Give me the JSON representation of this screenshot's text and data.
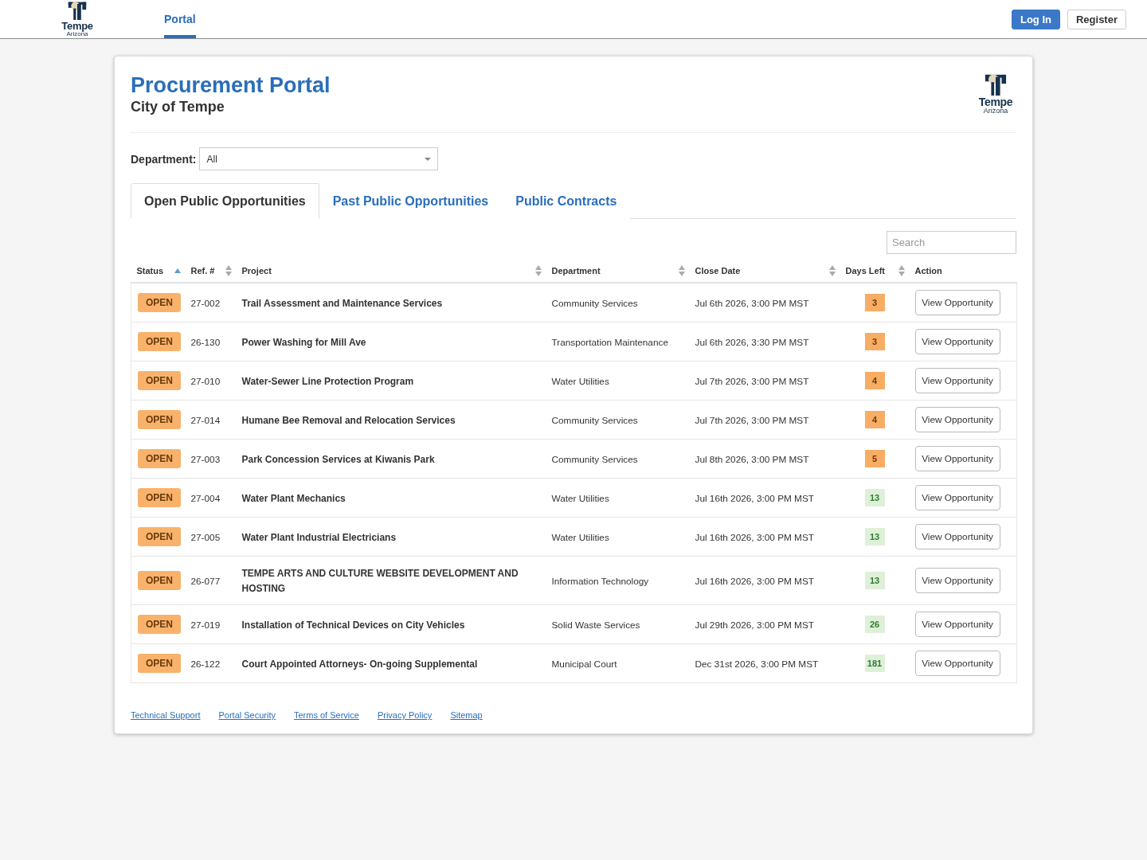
{
  "top_bar": {
    "logo": {
      "name": "Tempe",
      "region": "Arizona"
    },
    "nav": [
      {
        "label": "Portal",
        "selected": true
      }
    ],
    "buttons": [
      {
        "label": "Log In",
        "kind": "primary"
      },
      {
        "label": "Register",
        "kind": "secondary"
      }
    ]
  },
  "header": {
    "title": "Procurement Portal",
    "subtitle": "City of Tempe",
    "logo": {
      "name": "Tempe",
      "region": "Arizona"
    }
  },
  "filter": {
    "label": "Department:",
    "value": "All"
  },
  "tabs": [
    {
      "label": "Open Public Opportunities",
      "selected": true
    },
    {
      "label": "Past Public Opportunities",
      "selected": false
    },
    {
      "label": "Public Contracts",
      "selected": false
    }
  ],
  "search": {
    "placeholder": "Search"
  },
  "table": {
    "columns": [
      {
        "label": "Status",
        "sorted": true
      },
      {
        "label": "Ref. #",
        "sorted": false
      },
      {
        "label": "Project",
        "sorted": false
      },
      {
        "label": "Department",
        "sorted": false
      },
      {
        "label": "Close Date",
        "sorted": false
      },
      {
        "label": "Days Left",
        "sorted": false
      },
      {
        "label": "Action"
      }
    ],
    "rows": [
      {
        "status": "OPEN",
        "ref": "27-002",
        "project": "Trail Assessment and Maintenance Services",
        "department": "Community Services",
        "close_date": "Jul 6th 2026, 3:00 PM MST",
        "days_left": {
          "text": "3",
          "kind": "warning"
        },
        "action": "View Opportunity"
      },
      {
        "status": "OPEN",
        "ref": "26-130",
        "project": "Power Washing for Mill Ave",
        "department": "Transportation Maintenance",
        "close_date": "Jul 6th 2026, 3:30 PM MST",
        "days_left": {
          "text": "3",
          "kind": "warning"
        },
        "action": "View Opportunity"
      },
      {
        "status": "OPEN",
        "ref": "27-010",
        "project": "Water-Sewer Line Protection Program",
        "department": "Water Utilities",
        "close_date": "Jul 7th 2026, 3:00 PM MST",
        "days_left": {
          "text": "4",
          "kind": "warning"
        },
        "action": "View Opportunity"
      },
      {
        "status": "OPEN",
        "ref": "27-014",
        "project": "Humane Bee Removal and Relocation Services",
        "department": "Community Services",
        "close_date": "Jul 7th 2026, 3:00 PM MST",
        "days_left": {
          "text": "4",
          "kind": "warning"
        },
        "action": "View Opportunity"
      },
      {
        "status": "OPEN",
        "ref": "27-003",
        "project": "Park Concession Services at Kiwanis Park",
        "department": "Community Services",
        "close_date": "Jul 8th 2026, 3:00 PM MST",
        "days_left": {
          "text": "5",
          "kind": "warning"
        },
        "action": "View Opportunity"
      },
      {
        "status": "OPEN",
        "ref": "27-004",
        "project": "Water Plant Mechanics",
        "department": "Water Utilities",
        "close_date": "Jul 16th 2026, 3:00 PM MST",
        "days_left": {
          "text": "13",
          "kind": "ok"
        },
        "action": "View Opportunity"
      },
      {
        "status": "OPEN",
        "ref": "27-005",
        "project": "Water Plant Industrial Electricians",
        "department": "Water Utilities",
        "close_date": "Jul 16th 2026, 3:00 PM MST",
        "days_left": {
          "text": "13",
          "kind": "ok"
        },
        "action": "View Opportunity"
      },
      {
        "status": "OPEN",
        "ref": "26-077",
        "project": "TEMPE ARTS AND CULTURE WEBSITE DEVELOPMENT AND HOSTING",
        "department": "Information Technology",
        "close_date": "Jul 16th 2026, 3:00 PM MST",
        "days_left": {
          "text": "13",
          "kind": "ok"
        },
        "action": "View Opportunity"
      },
      {
        "status": "OPEN",
        "ref": "27-019",
        "project": "Installation of Technical Devices on City Vehicles",
        "department": "Solid Waste Services",
        "close_date": "Jul 29th 2026, 3:00 PM MST",
        "days_left": {
          "text": "26",
          "kind": "ok"
        },
        "action": "View Opportunity"
      },
      {
        "status": "OPEN",
        "ref": "26-122",
        "project": "Court Appointed Attorneys- On-going Supplemental",
        "department": "Municipal Court",
        "close_date": "Dec 31st 2026, 3:00 PM MST",
        "days_left": {
          "text": "181",
          "kind": "ok"
        },
        "action": "View Opportunity"
      }
    ]
  },
  "footer_links": [
    "Technical Support",
    "Portal Security",
    "Terms of Service",
    "Privacy Policy",
    "Sitemap"
  ]
}
